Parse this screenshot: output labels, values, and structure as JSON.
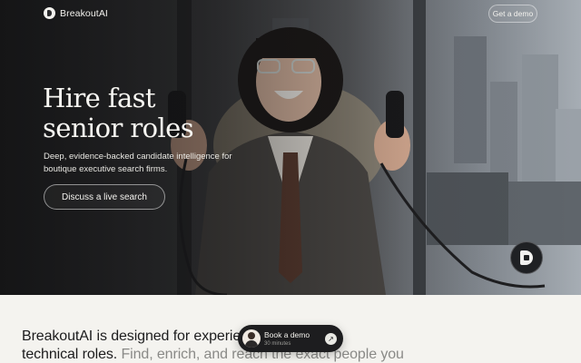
{
  "nav": {
    "brand": "BreakoutAI",
    "logo_icon": "breakout-logo-icon",
    "demo_label": "Get a demo"
  },
  "hero": {
    "title_line1": "Hire fast",
    "title_line2": "senior roles",
    "subtitle": "Deep, evidence-backed candidate intelligence for boutique executive search firms.",
    "cta_label": "Discuss a live search",
    "badge_icon": "breakout-logo-icon"
  },
  "intro": {
    "line1": "BreakoutAI is designed for experienced senior",
    "line2_dark": "technical roles.",
    "line2_muted": " Find, enrich, and reach the exact people you"
  },
  "floating_demo": {
    "title": "Book a demo",
    "subtitle": "30 minutes",
    "arrow_icon": "arrow-up-right-icon"
  },
  "colors": {
    "background": "#f4f3ef",
    "text_dark": "#1c1c1d",
    "text_muted": "#8a8a87",
    "pill": "#1d1d1f"
  }
}
